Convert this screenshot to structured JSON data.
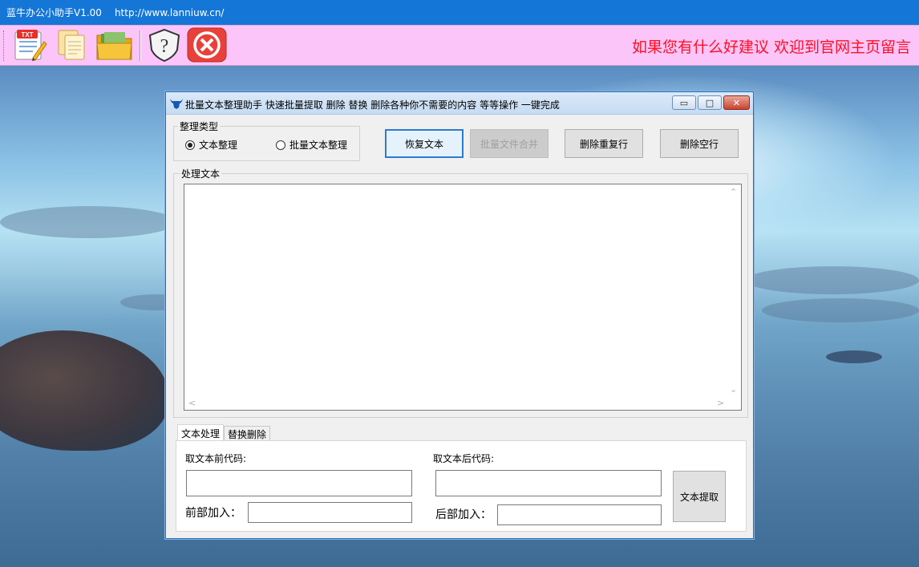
{
  "window": {
    "title": "蓝牛办公小助手V1.00",
    "url": "http://www.lanniuw.cn/"
  },
  "toolbar": {
    "buttons": [
      {
        "name": "txt-edit",
        "icon": "txt-notepad-icon"
      },
      {
        "name": "copy",
        "icon": "documents-icon"
      },
      {
        "name": "folder",
        "icon": "folder-icon"
      },
      {
        "name": "help",
        "icon": "help-shield-icon"
      },
      {
        "name": "exit",
        "icon": "close-circle-icon"
      }
    ],
    "txt_badge": "TXT",
    "message": "如果您有什么好建议 欢迎到官网主页留言",
    "message_color": "#ff0f24"
  },
  "app": {
    "caption": "批量文本整理助手   快速批量提取 删除  替换 删除各种你不需要的内容 等等操作 一键完成",
    "min_label": "▭",
    "max_label": "□",
    "close_label": "✕",
    "type_group": {
      "legend": "整理类型",
      "options": [
        {
          "label": "文本整理",
          "checked": true
        },
        {
          "label": "批量文本整理",
          "checked": false
        }
      ]
    },
    "buttons": {
      "restore": "恢复文本",
      "merge": "批量文件合并",
      "dedupe": "删除重复行",
      "remove_blank": "删除空行"
    },
    "process_group": {
      "legend": "处理文本",
      "text": ""
    },
    "tabs": [
      {
        "label": "文本处理",
        "active": true
      },
      {
        "label": "替换删除",
        "active": false
      }
    ],
    "extract": {
      "before_code_label": "取文本前代码:",
      "after_code_label": "取文本后代码:",
      "prefix_label": "前部加入：",
      "suffix_label": "后部加入：",
      "before_code_value": "",
      "after_code_value": "",
      "prefix_value": "",
      "suffix_value": "",
      "extract_button": "文本提取"
    }
  }
}
